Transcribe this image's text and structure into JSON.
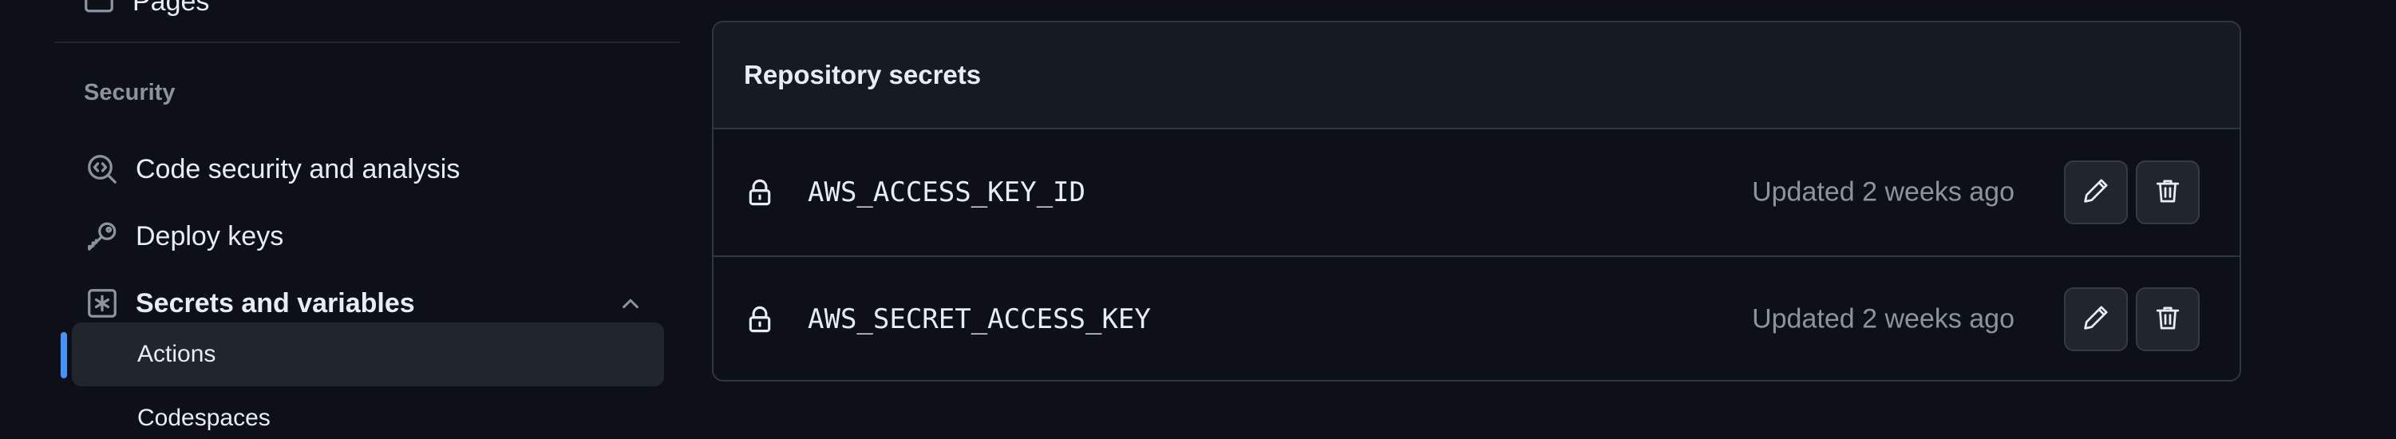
{
  "sidebar": {
    "top_item": {
      "label": "Pages",
      "icon": "browser-icon"
    },
    "section_heading": "Security",
    "items": [
      {
        "label": "Code security and analysis",
        "icon": "codescan-icon"
      },
      {
        "label": "Deploy keys",
        "icon": "key-icon"
      },
      {
        "label": "Secrets and variables",
        "icon": "key-asterisk-icon",
        "expanded": true
      }
    ],
    "sub_items": [
      {
        "label": "Actions",
        "active": true
      },
      {
        "label": "Codespaces",
        "active": false
      }
    ]
  },
  "secrets_panel": {
    "title": "Repository secrets",
    "rows": [
      {
        "name": "AWS_ACCESS_KEY_ID",
        "updated": "Updated 2 weeks ago",
        "icon": "lock-icon"
      },
      {
        "name": "AWS_SECRET_ACCESS_KEY",
        "updated": "Updated 2 weeks ago",
        "icon": "lock-icon"
      }
    ],
    "actions": {
      "edit_icon": "pencil-icon",
      "delete_icon": "trash-icon"
    }
  },
  "colors": {
    "background": "#0d1117",
    "panel_header": "#161b22",
    "border": "#30363d",
    "active_bg": "#21262d",
    "accent": "#4493f8",
    "text": "#e6edf3",
    "muted": "#8b949e"
  }
}
